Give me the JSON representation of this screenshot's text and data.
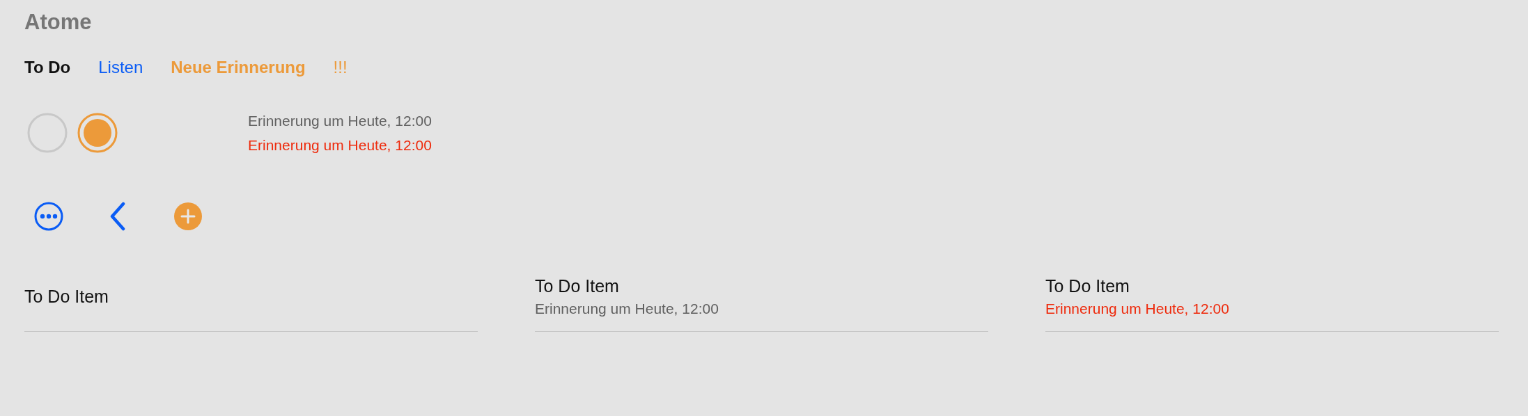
{
  "title": "Atome",
  "nav_items": [
    {
      "label": "To Do",
      "kind": "heading"
    },
    {
      "label": "Listen",
      "kind": "link"
    },
    {
      "label": "Neue Erinnerung",
      "kind": "action"
    },
    {
      "label": "!!!",
      "kind": "priority"
    }
  ],
  "checkboxes": [
    {
      "checked": false
    },
    {
      "checked": true
    }
  ],
  "reminders": [
    {
      "text": "Erinnerung um Heute, 12:00",
      "overdue": false
    },
    {
      "text": "Erinnerung um Heute, 12:00",
      "overdue": true
    }
  ],
  "icon_buttons": [
    {
      "kind": "more"
    },
    {
      "kind": "back"
    },
    {
      "kind": "add"
    }
  ],
  "todo_items": [
    {
      "title": "To Do Item"
    },
    {
      "title": "To Do Item",
      "reminder": "Erinnerung um Heute, 12:00",
      "overdue": false
    },
    {
      "title": "To Do Item",
      "reminder": "Erinnerung um Heute, 12:00",
      "overdue": true
    }
  ]
}
